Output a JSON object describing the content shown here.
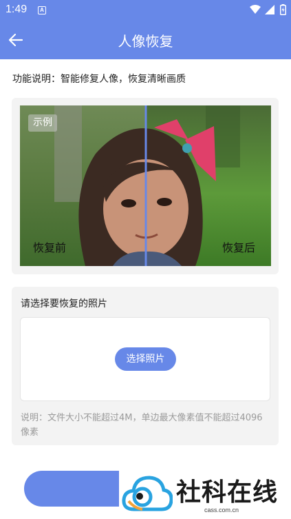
{
  "status_bar": {
    "time": "1:49",
    "notification_icon_letter": "A"
  },
  "app_bar": {
    "title": "人像恢复",
    "back_icon": "arrow-left-icon"
  },
  "description": "功能说明：智能修复人像，恢复清晰画质",
  "example": {
    "badge": "示例",
    "before_label": "恢复前",
    "after_label": "恢复后"
  },
  "upload": {
    "heading": "请选择要恢复的照片",
    "button_label": "选择照片",
    "note": "说明：文件大小不能超过4M，单边最大像素值不能超过4096像素"
  },
  "watermark": {
    "brand": "社科在线",
    "url": "cass.com.cn"
  },
  "colors": {
    "primary": "#6788e8",
    "card": "#f3f3f3",
    "note_text": "#9a9a9a"
  }
}
